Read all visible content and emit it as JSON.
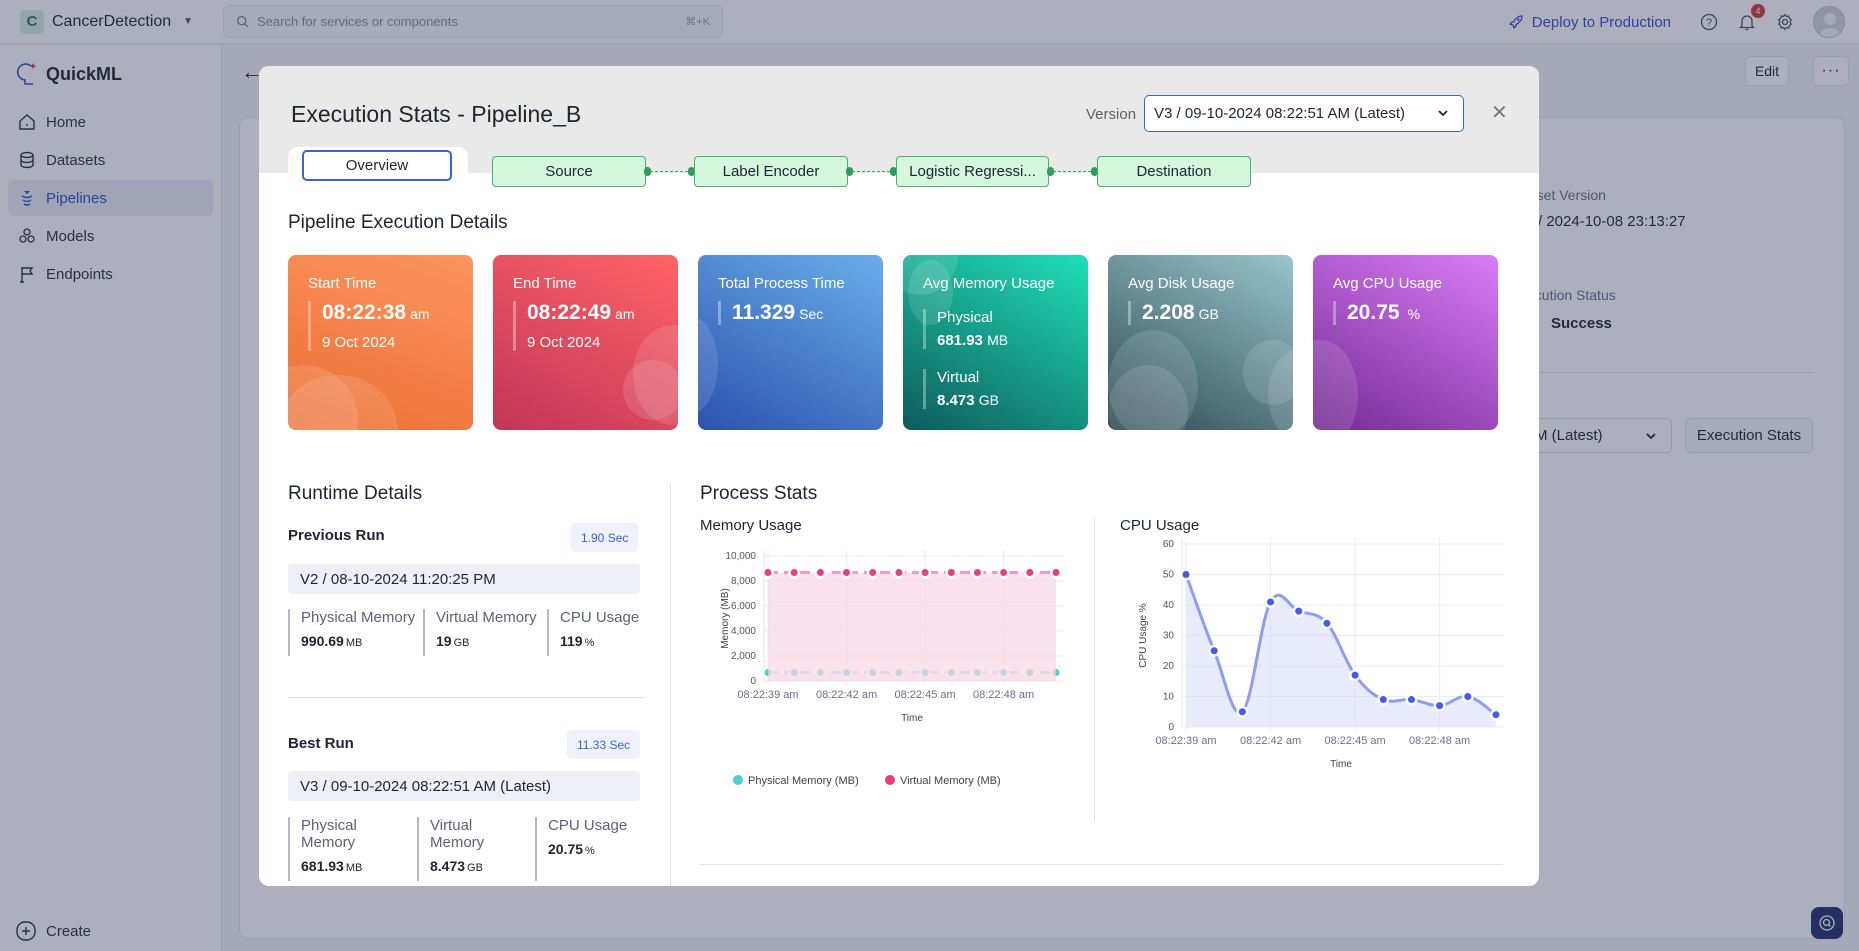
{
  "topbar": {
    "project_initial": "C",
    "project_name": "CancerDetection",
    "search_placeholder": "Search for services or components",
    "search_shortcut": "⌘+K",
    "deploy_label": "Deploy to Production",
    "notification_count": "4"
  },
  "sidebar": {
    "app_name": "QuickML",
    "items": [
      {
        "label": "Home",
        "icon": "home-icon",
        "active": false
      },
      {
        "label": "Datasets",
        "icon": "database-icon",
        "active": false
      },
      {
        "label": "Pipelines",
        "icon": "pipeline-icon",
        "active": true
      },
      {
        "label": "Models",
        "icon": "models-icon",
        "active": false
      },
      {
        "label": "Endpoints",
        "icon": "flag-icon",
        "active": false
      }
    ],
    "create_label": "Create"
  },
  "background_page": {
    "edit_label": "Edit",
    "more_label": "···",
    "dataset_version_label": "taset Version",
    "dataset_version_value": "/ 2024-10-08 23:13:27",
    "execution_status_label": "ecution Status",
    "execution_status_value": "Success",
    "version_select_value": "AM (Latest)",
    "execution_stats_button": "Execution Stats"
  },
  "modal": {
    "title": "Execution Stats - Pipeline_B",
    "version_label": "Version",
    "version_value": "V3 / 09-10-2024 08:22:51 AM (Latest)",
    "tabs": {
      "overview": "Overview",
      "nodes": [
        "Source",
        "Label Encoder",
        "Logistic Regressi...",
        "Destination"
      ]
    },
    "execution_details_title": "Pipeline Execution Details",
    "cards": {
      "start": {
        "title": "Start Time",
        "time": "08:22:38",
        "ampm": "am",
        "date": "9 Oct 2024"
      },
      "end": {
        "title": "End Time",
        "time": "08:22:49",
        "ampm": "am",
        "date": "9 Oct 2024"
      },
      "total": {
        "title": "Total Process Time",
        "value": "11.329",
        "unit": "Sec"
      },
      "memory": {
        "title": "Avg Memory Usage",
        "physical_label": "Physical",
        "physical_value": "681.93",
        "physical_unit": "MB",
        "virtual_label": "Virtual",
        "virtual_value": "8.473",
        "virtual_unit": "GB"
      },
      "disk": {
        "title": "Avg Disk Usage",
        "value": "2.208",
        "unit": "GB"
      },
      "cpu": {
        "title": "Avg CPU Usage",
        "value": "20.75",
        "unit": "%"
      }
    },
    "runtime": {
      "title": "Runtime Details",
      "previous": {
        "label": "Previous Run",
        "duration": "1.90 Sec",
        "version": "V2 / 08-10-2024 11:20:25 PM",
        "physical_label": "Physical Memory",
        "physical_value": "990.69",
        "physical_unit": "MB",
        "virtual_label": "Virtual Memory",
        "virtual_value": "19",
        "virtual_unit": "GB",
        "cpu_label": "CPU Usage",
        "cpu_value": "119",
        "cpu_unit": "%"
      },
      "best": {
        "label": "Best Run",
        "duration": "11.33 Sec",
        "version": "V3 / 09-10-2024 08:22:51 AM (Latest)",
        "physical_label": "Physical Memory",
        "physical_value": "681.93",
        "physical_unit": "MB",
        "virtual_label": "Virtual Memory",
        "virtual_value": "8.473",
        "virtual_unit": "GB",
        "cpu_label": "CPU Usage",
        "cpu_value": "20.75",
        "cpu_unit": "%"
      }
    },
    "process_stats_title": "Process Stats"
  },
  "chart_data": [
    {
      "type": "area",
      "title": "Memory Usage",
      "xlabel": "Time",
      "ylabel": "Memory (MB)",
      "ylim": [
        0,
        10000
      ],
      "yticks": [
        0,
        2000,
        4000,
        6000,
        8000,
        10000
      ],
      "ytick_labels": [
        "0",
        "2,000",
        "4,000",
        "6,000",
        "8,000",
        "10,000"
      ],
      "x": [
        "08:22:39 am",
        "08:22:40 am",
        "08:22:41 am",
        "08:22:42 am",
        "08:22:43 am",
        "08:22:44 am",
        "08:22:45 am",
        "08:22:46 am",
        "08:22:47 am",
        "08:22:48 am",
        "08:22:49 am",
        "08:22:50 am"
      ],
      "xtick_labels": [
        "08:22:39 am",
        "08:22:42 am",
        "08:22:45 am",
        "08:22:48 am"
      ],
      "grid": true,
      "legend": "bottom",
      "series": [
        {
          "name": "Physical Memory (MB)",
          "color": "#4ecdd4",
          "values": [
            680,
            680,
            680,
            680,
            680,
            680,
            680,
            680,
            680,
            680,
            680,
            680
          ]
        },
        {
          "name": "Virtual Memory (MB)",
          "color": "#e83e7f",
          "values": [
            8680,
            8680,
            8680,
            8680,
            8680,
            8680,
            8680,
            8680,
            8680,
            8680,
            8680,
            8680
          ]
        }
      ]
    },
    {
      "type": "area",
      "title": "CPU Usage",
      "xlabel": "Time",
      "ylabel": "CPU Usage %",
      "ylim": [
        0,
        60
      ],
      "yticks": [
        0,
        10,
        20,
        30,
        40,
        50,
        60
      ],
      "ytick_labels": [
        "0",
        "10",
        "20",
        "30",
        "40",
        "50",
        "60"
      ],
      "x": [
        "08:22:39 am",
        "08:22:40 am",
        "08:22:41 am",
        "08:22:42 am",
        "08:22:43 am",
        "08:22:44 am",
        "08:22:45 am",
        "08:22:46 am",
        "08:22:47 am",
        "08:22:48 am",
        "08:22:49 am",
        "08:22:50 am"
      ],
      "xtick_labels": [
        "08:22:39 am",
        "08:22:42 am",
        "08:22:45 am",
        "08:22:48 am"
      ],
      "grid": true,
      "series": [
        {
          "name": "CPU Usage %",
          "color": "#4a5ae8",
          "values": [
            50,
            25,
            5,
            41,
            38,
            34,
            17,
            9,
            9,
            7,
            10,
            4
          ]
        }
      ]
    }
  ]
}
